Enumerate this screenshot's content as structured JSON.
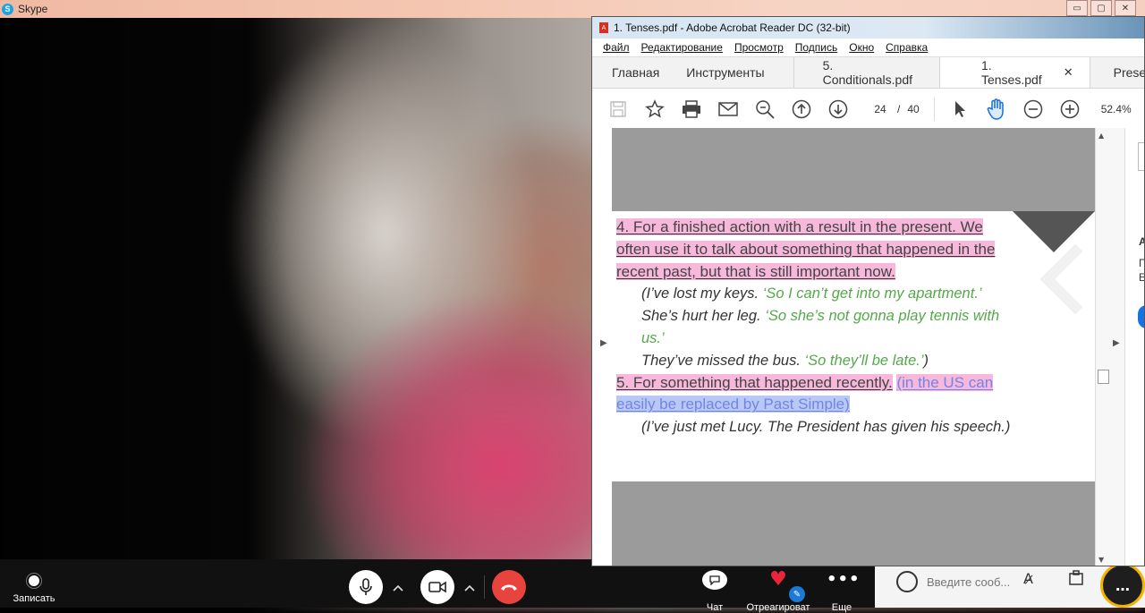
{
  "skype": {
    "title": "Skype",
    "logo": "S",
    "window_controls": [
      "▭",
      "▢",
      "✕"
    ],
    "record_label": "Записать",
    "chat_label": "Чат",
    "react_label": "Отреагироват",
    "more_label": "Еще",
    "message_placeholder": "Введите сооб...",
    "icons": [
      "mic-icon",
      "camera-icon",
      "hang-up-icon",
      "chat-icon",
      "heart-icon",
      "more-icon",
      "emoji-icon",
      "spellcheck-icon",
      "attach-icon"
    ]
  },
  "acrobat": {
    "title": "1. Tenses.pdf - Adobe Acrobat Reader DC (32-bit)",
    "menu": [
      "Файл",
      "Редактирование",
      "Просмотр",
      "Подпись",
      "Окно",
      "Справка"
    ],
    "tabs": {
      "home": "Главная",
      "tools": "Инструменты",
      "doc1": "5. Conditionals.pdf",
      "doc2": "1. Tenses.pdf",
      "doc3": "Prese"
    },
    "page_current": "24",
    "page_sep": "/",
    "page_total": "40",
    "zoom": "52.4%",
    "right_panel": {
      "letter1": "A",
      "letter2": "П",
      "letter3": "E"
    }
  },
  "pdf": {
    "item4_heading": "4. For a finished action with a result in the present. We often use it to talk about something that happened in the recent past, but that is still important now.",
    "ex1_plain": "(I’ve lost my keys. ",
    "ex1_green": "‘So I can’t get into my apartment.’",
    "ex2_plain": "She’s hurt her leg. ",
    "ex2_green": "‘So she’s not gonna play tennis with us.’",
    "ex3_plain": "They’ve missed the bus. ",
    "ex3_green": "‘So they’ll be late.’",
    "ex3_close": ")",
    "item5_heading": "5. For something that happened recently.",
    "item5_note_a": "(in the US can",
    "item5_note_b": "easily be replaced by Past Simple)",
    "ex4": "(I’ve just met Lucy. The President has given his speech.)"
  },
  "colors": {
    "highlight_pink": "#f7b8dc",
    "highlight_blue": "#b9c8f5",
    "example_green": "#55a84a",
    "hangup_red": "#e8433d"
  }
}
